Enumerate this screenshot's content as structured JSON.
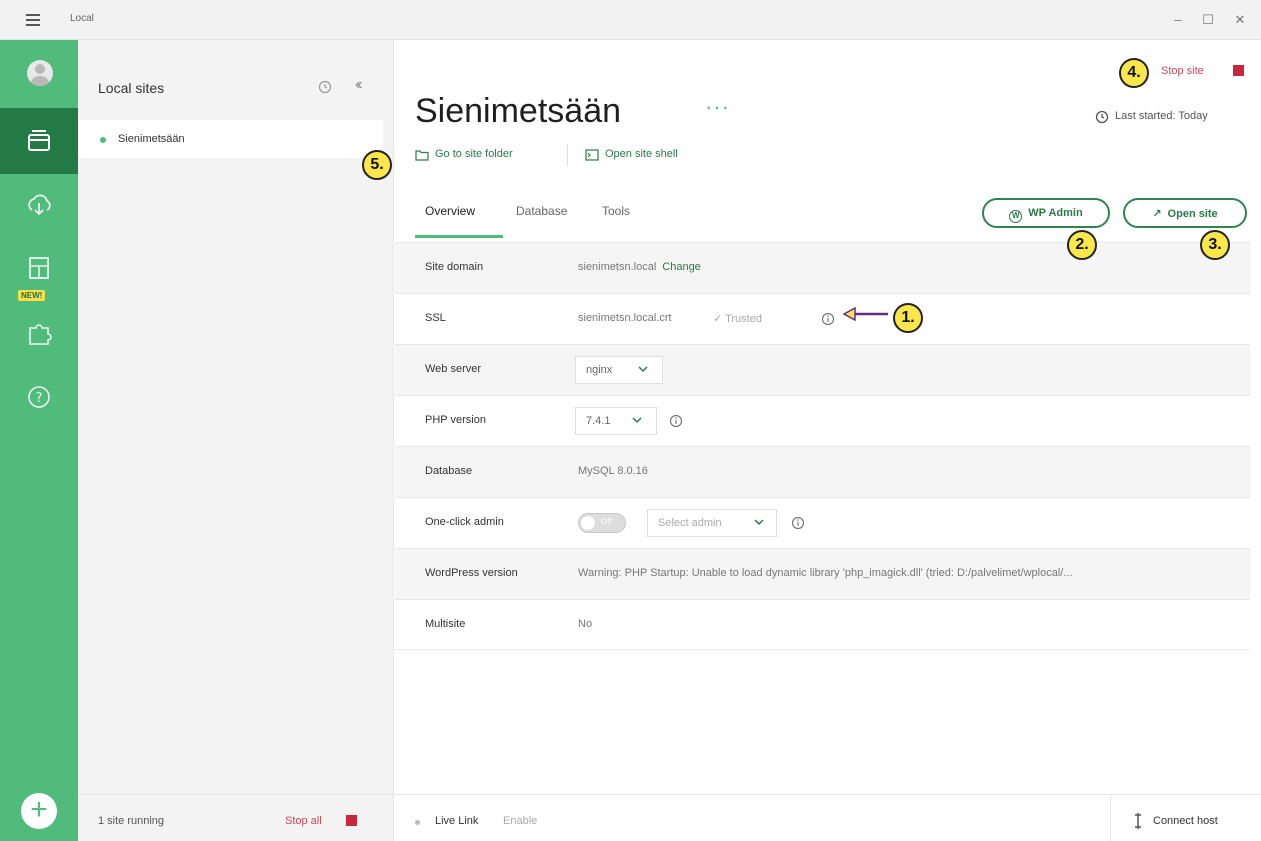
{
  "window": {
    "title": "Local"
  },
  "sidebar_rail": {
    "new_badge": "NEW!",
    "add_symbol": "+"
  },
  "sites_panel": {
    "title": "Local sites",
    "sites": [
      {
        "name": "Sienimetsään",
        "status": "running"
      }
    ],
    "footer": {
      "running": "1 site running",
      "stop_all": "Stop all"
    }
  },
  "site": {
    "title": "Sienimetsään",
    "more": "···",
    "go_to_folder": "Go to site folder",
    "open_shell": "Open site shell",
    "stop_site": "Stop site",
    "last_started": "Last started: Today",
    "wp_admin": "WP Admin",
    "open_site": "Open site"
  },
  "tabs": [
    {
      "label": "Overview",
      "active": true
    },
    {
      "label": "Database",
      "active": false
    },
    {
      "label": "Tools",
      "active": false
    }
  ],
  "details": {
    "site_domain": {
      "label": "Site domain",
      "value": "sienimetsn.local",
      "action": "Change"
    },
    "ssl": {
      "label": "SSL",
      "value": "sienimetsn.local.crt",
      "status": "✓ Trusted"
    },
    "web_server": {
      "label": "Web server",
      "value": "nginx"
    },
    "php_version": {
      "label": "PHP version",
      "value": "7.4.1"
    },
    "database": {
      "label": "Database",
      "value": "MySQL 8.0.16"
    },
    "one_click_admin": {
      "label": "One-click admin",
      "toggle": "Off",
      "placeholder": "Select admin"
    },
    "wordpress_version": {
      "label": "WordPress version",
      "value": "Warning: PHP Startup: Unable to load dynamic library 'php_imagick.dll' (tried: D:/palvelimet/wplocal/..."
    },
    "multisite": {
      "label": "Multisite",
      "value": "No"
    }
  },
  "footer": {
    "live_link": "Live Link",
    "enable": "Enable",
    "connect_host": "Connect host"
  },
  "callouts": [
    "1.",
    "2.",
    "3.",
    "4.",
    "5."
  ],
  "colors": {
    "brand_green": "#51bb7b",
    "dark_green": "#247a45",
    "stop_red": "#c8283c",
    "callout_yellow": "#fbe74c"
  }
}
